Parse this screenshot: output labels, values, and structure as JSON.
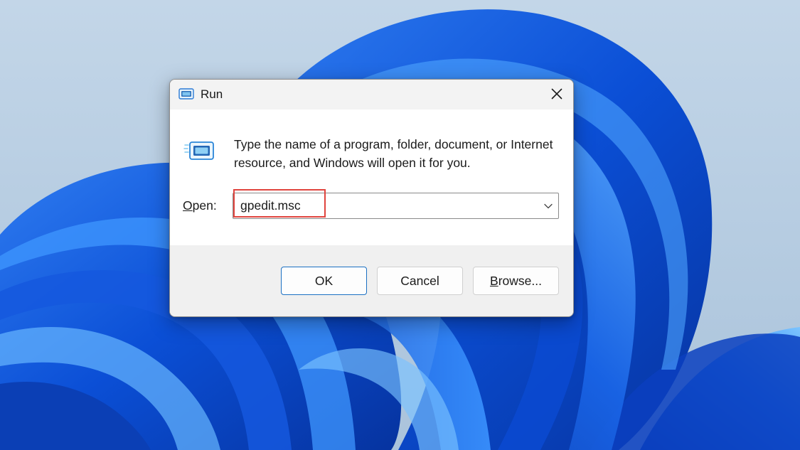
{
  "window": {
    "title": "Run",
    "icon": "run-icon",
    "close_icon": "close-icon"
  },
  "content": {
    "description": "Type the name of a program, folder, document, or Internet resource, and Windows will open it for you.",
    "open_label_mnemonic": "O",
    "open_label_rest": "pen:",
    "open_value": "gpedit.msc",
    "dropdown_icon": "chevron-down-icon"
  },
  "buttons": {
    "ok": "OK",
    "cancel": "Cancel",
    "browse_mnemonic": "B",
    "browse_rest": "rowse..."
  },
  "colors": {
    "highlight": "#e0443e",
    "ok_border": "#1a6fc2",
    "wallpaper_dark": "#0a3fc0",
    "wallpaper_light": "#4aa3ff"
  }
}
